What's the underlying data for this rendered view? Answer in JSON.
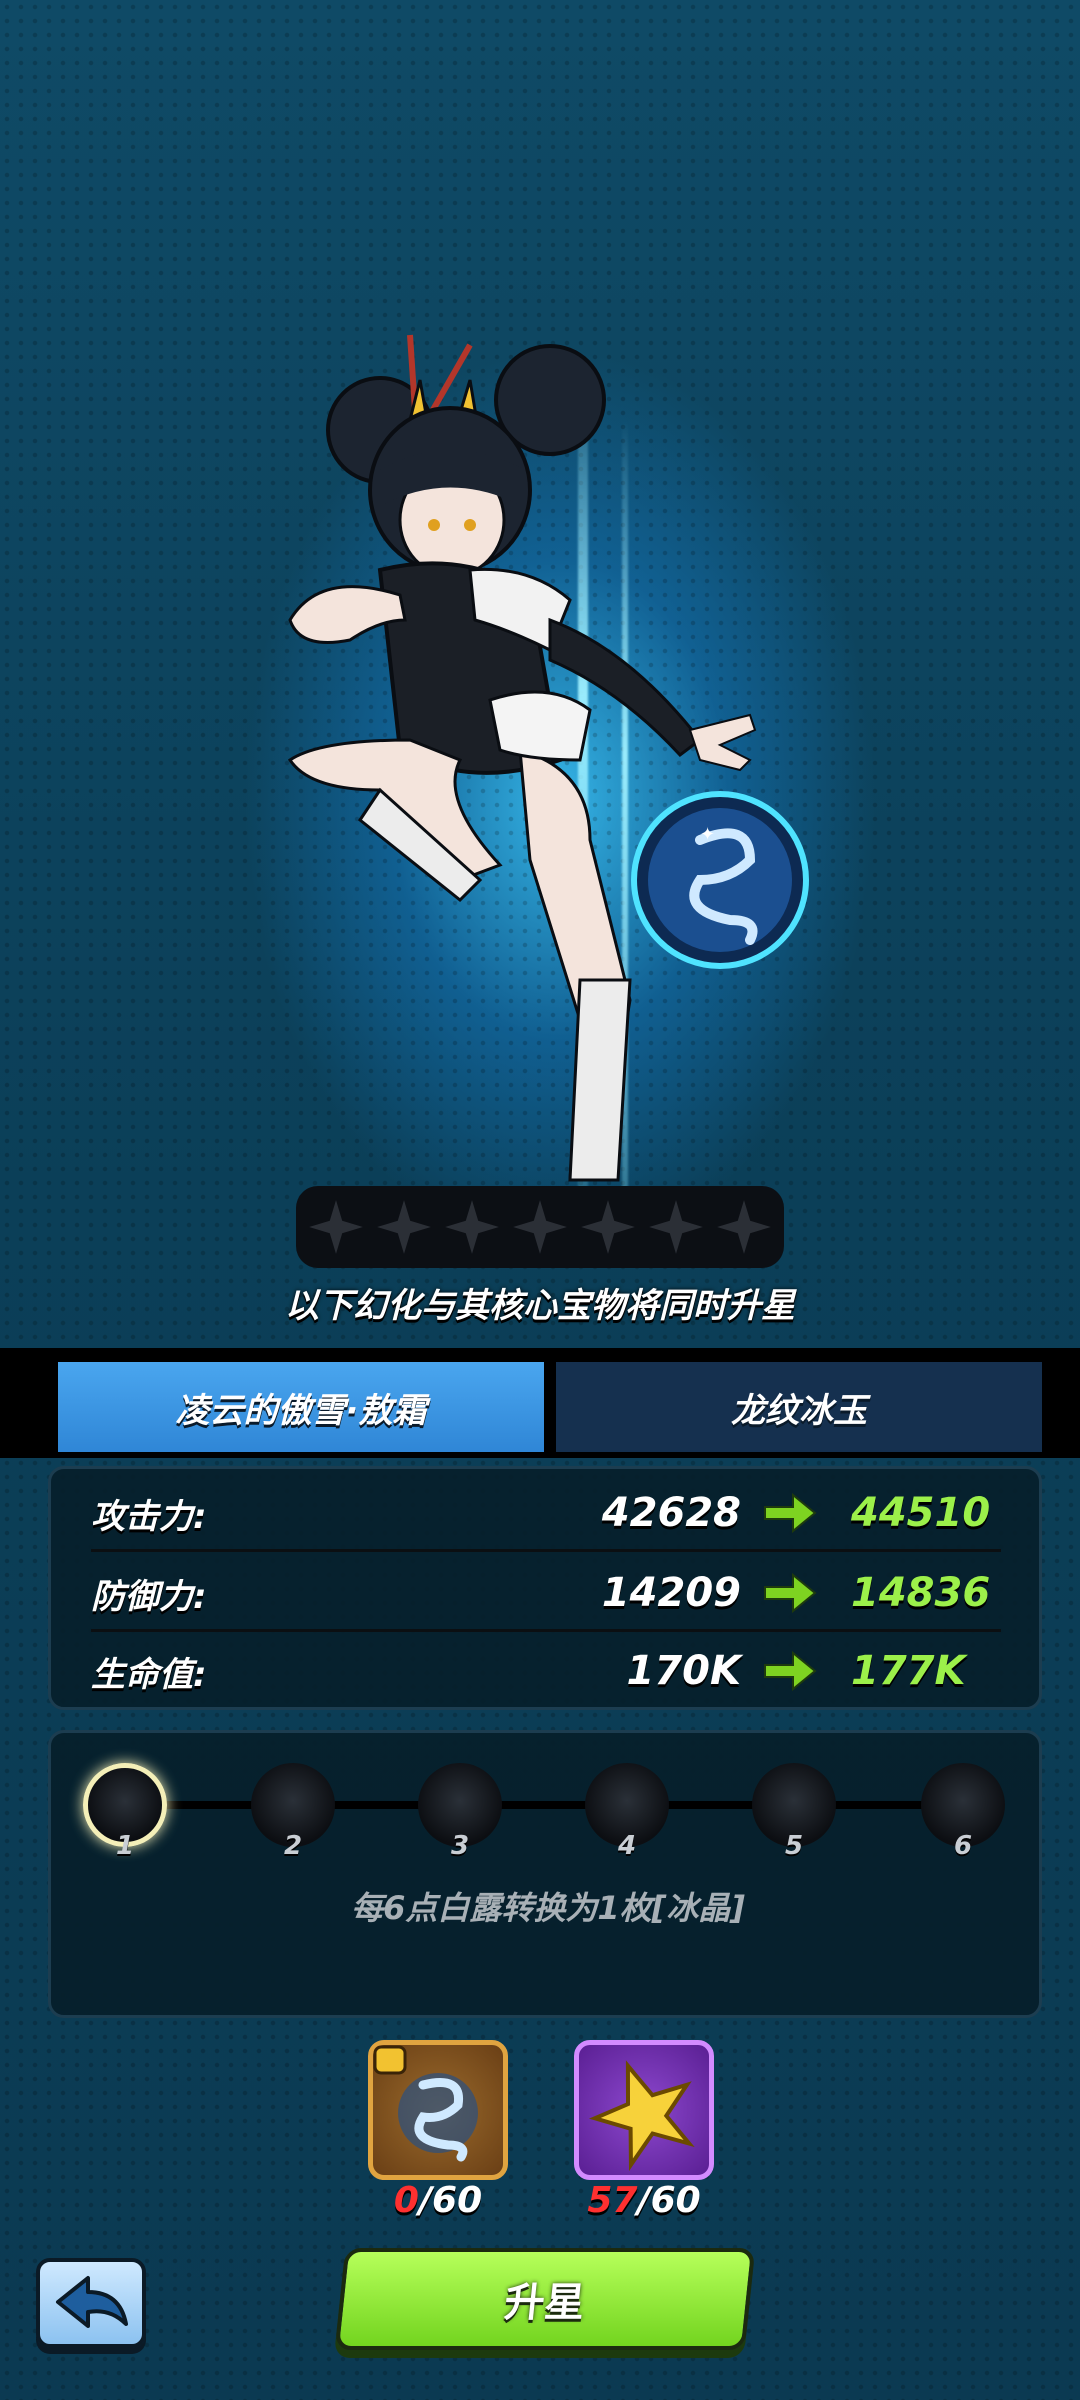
{
  "star_bar": {
    "filled": 0,
    "total": 7
  },
  "notice": "以下幻化与其核心宝物将同时升星",
  "tabs": [
    {
      "label": "凌云的傲雪·敖霜",
      "active": true
    },
    {
      "label": "龙纹冰玉",
      "active": false
    }
  ],
  "stats": [
    {
      "label": "攻击力:",
      "old": "42628",
      "new": "44510"
    },
    {
      "label": "防御力:",
      "old": "14209",
      "new": "14836"
    },
    {
      "label": "生命值:",
      "old": "170K",
      "new": "177K"
    }
  ],
  "nodes": {
    "labels": [
      "1",
      "2",
      "3",
      "4",
      "5",
      "6"
    ],
    "active_index": 0
  },
  "conversion_text": "每6点白露转换为1枚[冰晶]",
  "materials": [
    {
      "name": "dragon-fragment-icon",
      "have": "0",
      "need": "60"
    },
    {
      "name": "gold-star-icon",
      "have": "57",
      "need": "60"
    }
  ],
  "upgrade_button": "升星",
  "colors": {
    "accent_green": "#9cf04a",
    "tab_active": "#3a96e0",
    "low_count": "#ff3030"
  }
}
